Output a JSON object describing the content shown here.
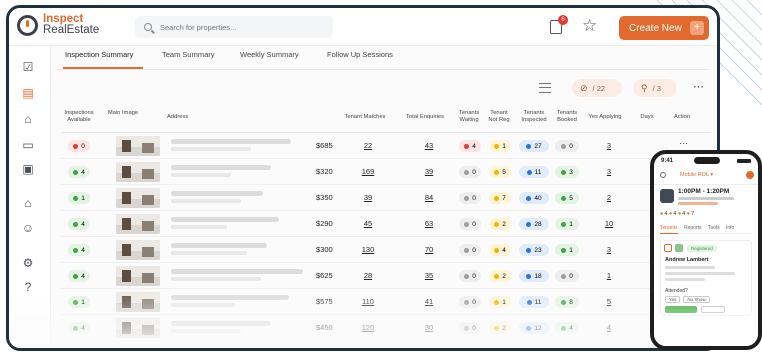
{
  "app": {
    "logo_line1": "Inspect",
    "logo_line2": "RealEstate",
    "search_placeholder": "Search for properties...",
    "notification_count": "6",
    "create_label": "Create New",
    "create_plus": "+",
    "accent_color": "#e36a2e"
  },
  "tabs": [
    "Inspection Summary",
    "Team Summary",
    "Weekly Summary",
    "Follow Up Sessions"
  ],
  "toolbar": {
    "hidden_count": "/ 22",
    "pinned_count": "/ 3",
    "hidden_icon": "eye-off-icon",
    "pinned_icon": "pin-icon"
  },
  "columns": {
    "available": "Inspections Available",
    "main_image": "Main Image",
    "address": "Address",
    "price": "",
    "tenant_matches": "Tenant Matches",
    "total_enquiries": "Total Enquiries",
    "tenants_waiting": "Tenants Waiting",
    "tenant_not_reg": "Tenant Not Reg",
    "tenants_inspected": "Tenants Inspected",
    "tenants_booked": "Tenants Booked",
    "yes_applying": "Yes Applying",
    "days": "Days",
    "action": "Action"
  },
  "rows": [
    {
      "available": "0",
      "available_color": "#e53935",
      "price": "$685",
      "matches": "22",
      "enquiries": "43",
      "waiting": "4",
      "not_reg": "1",
      "inspected": "27",
      "booked": "0",
      "applying": "3"
    },
    {
      "available": "4",
      "available_color": "#43a047",
      "price": "$320",
      "matches": "169",
      "enquiries": "39",
      "waiting": "0",
      "not_reg": "5",
      "inspected": "11",
      "booked": "3",
      "applying": "3"
    },
    {
      "available": "1",
      "available_color": "#43a047",
      "price": "$350",
      "matches": "39",
      "enquiries": "84",
      "waiting": "0",
      "not_reg": "7",
      "inspected": "40",
      "booked": "5",
      "applying": "2"
    },
    {
      "available": "4",
      "available_color": "#43a047",
      "price": "$290",
      "matches": "45",
      "enquiries": "63",
      "waiting": "0",
      "not_reg": "2",
      "inspected": "28",
      "booked": "1",
      "applying": "10"
    },
    {
      "available": "4",
      "available_color": "#43a047",
      "price": "$300",
      "matches": "130",
      "enquiries": "70",
      "waiting": "0",
      "not_reg": "4",
      "inspected": "23",
      "booked": "1",
      "applying": "3"
    },
    {
      "available": "4",
      "available_color": "#43a047",
      "price": "$625",
      "matches": "28",
      "enquiries": "35",
      "waiting": "0",
      "not_reg": "2",
      "inspected": "18",
      "booked": "0",
      "applying": "1"
    },
    {
      "available": "1",
      "available_color": "#43a047",
      "price": "$575",
      "matches": "110",
      "enquiries": "41",
      "waiting": "0",
      "not_reg": "1",
      "inspected": "11",
      "booked": "8",
      "applying": "5"
    },
    {
      "available": "4",
      "available_color": "#43a047",
      "price": "$450",
      "matches": "120",
      "enquiries": "30",
      "waiting": "0",
      "not_reg": "2",
      "inspected": "12",
      "booked": "4",
      "applying": "4"
    }
  ],
  "phone": {
    "clock": "9:41",
    "property_select": "Mobile ROL ▾",
    "session_time": "1:00PM - 1:20PM",
    "stats": [
      "4",
      "4",
      "4",
      "7"
    ],
    "tabs": [
      "Tenants",
      "Reports",
      "Tools",
      "Info"
    ],
    "badge": "Registered",
    "tenant_name": "Andrew Lambert",
    "question": "Attended?",
    "option_yes": "Yes",
    "option_no": "No Show"
  }
}
